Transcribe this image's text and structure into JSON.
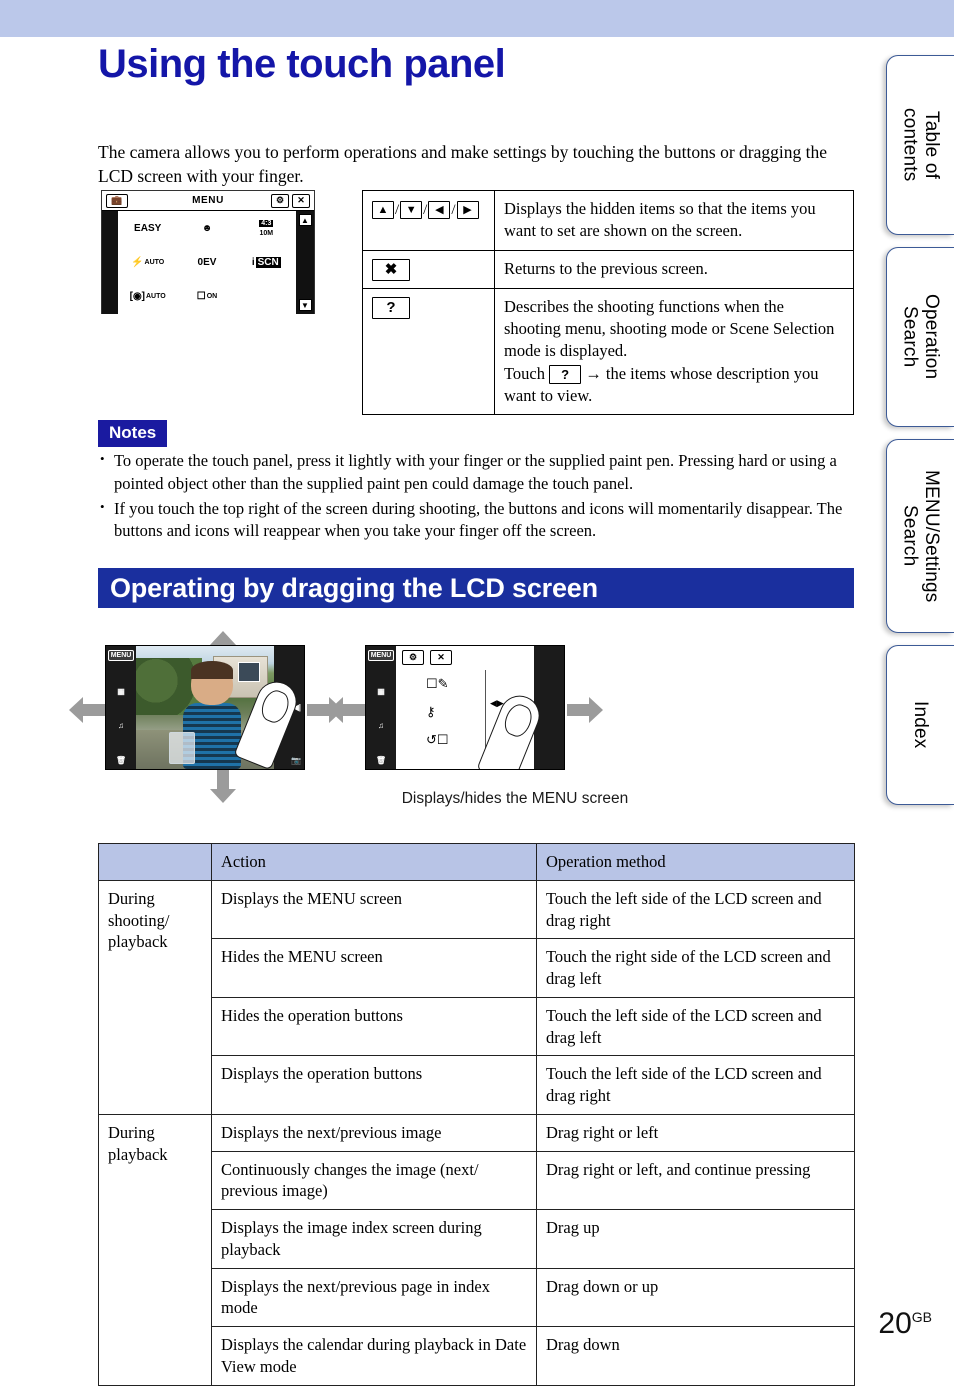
{
  "page": {
    "title": "Using the touch panel",
    "intro": "The camera allows you to perform operations and make settings by touching the buttons or dragging the LCD screen with your finger.",
    "number": "20",
    "number_suffix": "GB",
    "accent_blue": "#1416a8",
    "banner_blue": "#1a2f9e",
    "band_lavender": "#bbc8ea",
    "table_header_blue": "#b8c4e6"
  },
  "side_tabs": [
    {
      "label": "Table of\ncontents"
    },
    {
      "label": "Operation\nSearch"
    },
    {
      "label": "MENU/Settings\nSearch"
    },
    {
      "label": "Index"
    }
  ],
  "lcd_menu_mock": {
    "title": "MENU",
    "case_icon": "briefcase-icon",
    "gear_icon": "gear-icon",
    "close_icon": "close-icon",
    "scroll_up_icon": "triangle-up-icon",
    "scroll_down_icon": "triangle-down-icon",
    "items": [
      {
        "label": "EASY",
        "icon": "easy-mode-label"
      },
      {
        "label": "",
        "icon": "smile-shutter-icon"
      },
      {
        "label": "10M",
        "icon": "image-size-icon"
      },
      {
        "label": "AUTO",
        "icon": "flash-auto-icon"
      },
      {
        "label": "0EV",
        "icon": "ev-icon"
      },
      {
        "label": "SCN",
        "icon": "scene-selection-icon"
      },
      {
        "label": "AUTO",
        "icon": "face-detection-icon"
      },
      {
        "label": "ON",
        "icon": "display-icon"
      },
      {
        "label": "",
        "icon": ""
      }
    ]
  },
  "icon_table": {
    "rows": [
      {
        "icons": [
          "triangle-up-icon",
          "triangle-down-icon",
          "triangle-left-icon",
          "triangle-right-icon"
        ],
        "icon_glyphs": [
          "▲",
          "▼",
          "◀",
          "▶"
        ],
        "separator": "/",
        "description": "Displays the hidden items so that the items you want to set are shown on the screen."
      },
      {
        "icons": [
          "close-icon"
        ],
        "icon_glyphs": [
          "✖"
        ],
        "description": "Returns to the previous screen."
      },
      {
        "icons": [
          "help-icon"
        ],
        "icon_glyphs": [
          "?"
        ],
        "description_part1": "Describes the shooting functions when the shooting menu, shooting mode or Scene Selection mode is displayed.",
        "description_touch_prefix": "Touch",
        "description_touch_key": "?",
        "description_arrow": "→",
        "description_part2": "the items whose description you want to view."
      }
    ]
  },
  "notes": {
    "label": "Notes",
    "items": [
      "To operate the touch panel, press it lightly with your finger or the supplied paint pen. Pressing hard or using a pointed object other than the supplied paint pen could damage the touch panel.",
      "If you touch the top right of the screen during shooting, the buttons and icons will momentarily disappear. The buttons and icons will reappear when you take your finger off the screen."
    ]
  },
  "section": {
    "banner_title": "Operating by dragging the LCD screen",
    "illustration_caption": "Displays/hides the MENU screen",
    "lcd_left_icons": [
      "menu-chip-icon",
      "index-grid-icon",
      "slideshow-icon",
      "trash-icon"
    ],
    "lcd_left_labels": [
      "MENU",
      "",
      "",
      ""
    ],
    "lcd_right_icons": [
      "playback-prev-icon",
      "camera-mode-icon"
    ],
    "lcd_menu_panel_icons": [
      "resize-icon",
      "protect-icon",
      "rotate-icon"
    ],
    "lcd_menu_panel_top_icons": [
      "gear-icon",
      "close-icon"
    ]
  },
  "ops_table": {
    "headers": [
      "",
      "Action",
      "Operation method"
    ],
    "groups": [
      {
        "name": "During shooting/ playback",
        "rows": [
          {
            "action": "Displays the MENU screen",
            "method": "Touch the left side of the LCD screen and drag right"
          },
          {
            "action": "Hides the MENU screen",
            "method": "Touch the right side of the LCD screen and drag left"
          },
          {
            "action": "Hides the operation buttons",
            "method": "Touch the left side of the LCD screen and drag left"
          },
          {
            "action": "Displays the operation buttons",
            "method": "Touch the left side of the LCD screen and drag right"
          }
        ]
      },
      {
        "name": "During playback",
        "rows": [
          {
            "action": "Displays the next/previous image",
            "method": "Drag right or left"
          },
          {
            "action": "Continuously changes the image (next/ previous image)",
            "method": "Drag right or left, and continue pressing"
          },
          {
            "action": "Displays the image index screen during playback",
            "method": "Drag up"
          },
          {
            "action": "Displays the next/previous page in index mode",
            "method": "Drag down or up"
          },
          {
            "action": "Displays the calendar during playback in Date View mode",
            "method": "Drag down"
          }
        ]
      }
    ]
  }
}
